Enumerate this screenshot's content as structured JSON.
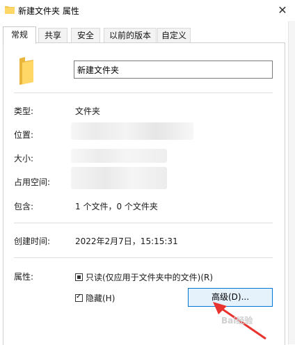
{
  "window": {
    "title": "新建文件夹 属性",
    "close_glyph": "✕",
    "folder_icon": "folder-icon"
  },
  "tabs": [
    {
      "label": "常规",
      "active": true
    },
    {
      "label": "共享",
      "active": false
    },
    {
      "label": "安全",
      "active": false
    },
    {
      "label": "以前的版本",
      "active": false
    },
    {
      "label": "自定义",
      "active": false
    }
  ],
  "name_field": {
    "value": "新建文件夹"
  },
  "props": {
    "type_label": "类型:",
    "type_value": "文件夹",
    "location_label": "位置:",
    "size_label": "大小:",
    "size_on_disk_label": "占用空间:",
    "contains_label": "包含:",
    "contains_value": "1 个文件，0 个文件夹",
    "created_label": "创建时间:",
    "created_value": "2022年2月7日，15:15:31"
  },
  "attributes": {
    "label": "属性:",
    "readonly_label": "只读(仅应用于文件夹中的文件)(R)",
    "readonly_state": "indeterminate",
    "hidden_label": "隐藏(H)",
    "hidden_state": "checked",
    "advanced_button": "高级(D)..."
  },
  "colors": {
    "accent": "#0078d7",
    "button_bg": "#e5f1fb",
    "arrow": "#e8332e",
    "folder": "#f3c74f"
  }
}
